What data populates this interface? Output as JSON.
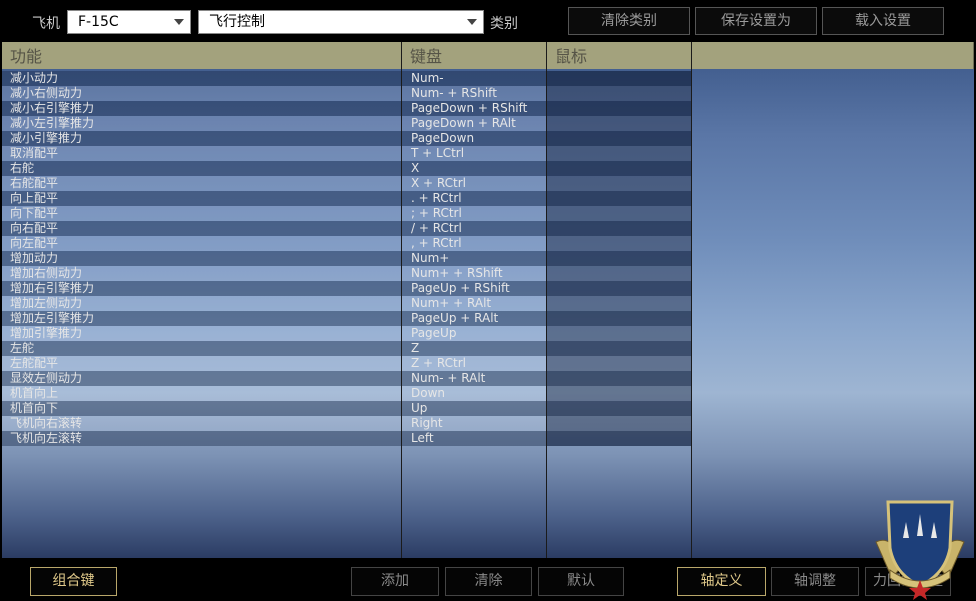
{
  "top": {
    "aircraft_label": "飞机",
    "aircraft_value": "F-15C",
    "category_value": "飞行控制",
    "category_label": "类别",
    "clear_category": "清除类别",
    "save_settings_as": "保存设置为",
    "load_settings": "载入设置"
  },
  "table": {
    "headers": [
      "功能",
      "键盘",
      "鼠标"
    ],
    "rows": [
      {
        "func": "减小动力",
        "key": "Num-"
      },
      {
        "func": "减小右侧动力",
        "key": "Num- + RShift"
      },
      {
        "func": "减小右引擎推力",
        "key": "PageDown + RShift"
      },
      {
        "func": "减小左引擎推力",
        "key": "PageDown + RAlt"
      },
      {
        "func": "减小引擎推力",
        "key": "PageDown"
      },
      {
        "func": "取消配平",
        "key": "T + LCtrl"
      },
      {
        "func": "右舵",
        "key": "X"
      },
      {
        "func": "右舵配平",
        "key": "X + RCtrl"
      },
      {
        "func": "向上配平",
        "key": ". + RCtrl"
      },
      {
        "func": "向下配平",
        "key": "; + RCtrl"
      },
      {
        "func": "向右配平",
        "key": "/ + RCtrl"
      },
      {
        "func": "向左配平",
        "key": ", + RCtrl"
      },
      {
        "func": "增加动力",
        "key": "Num+"
      },
      {
        "func": "增加右侧动力",
        "key": "Num+ + RShift"
      },
      {
        "func": "增加右引擎推力",
        "key": "PageUp + RShift"
      },
      {
        "func": "增加左侧动力",
        "key": "Num+ + RAlt"
      },
      {
        "func": "增加左引擎推力",
        "key": "PageUp + RAlt"
      },
      {
        "func": "增加引擎推力",
        "key": "PageUp"
      },
      {
        "func": "左舵",
        "key": "Z"
      },
      {
        "func": "左舵配平",
        "key": "Z + RCtrl"
      },
      {
        "func": "显效左侧动力",
        "key": "Num- + RAlt"
      },
      {
        "func": "机首向上",
        "key": "Down"
      },
      {
        "func": "机首向下",
        "key": "Up"
      },
      {
        "func": "飞机向右滚转",
        "key": "Right"
      },
      {
        "func": "飞机向左滚转",
        "key": "Left"
      }
    ]
  },
  "bottom": {
    "combo_key": "组合键",
    "add": "添加",
    "clear": "清除",
    "default": "默认",
    "axis_assign": "轴定义",
    "axis_tune": "轴调整",
    "force_feedback": "力回馈调整"
  },
  "colors": {
    "header_bg": "#a3a27d",
    "active_accent": "#e0c98a"
  }
}
